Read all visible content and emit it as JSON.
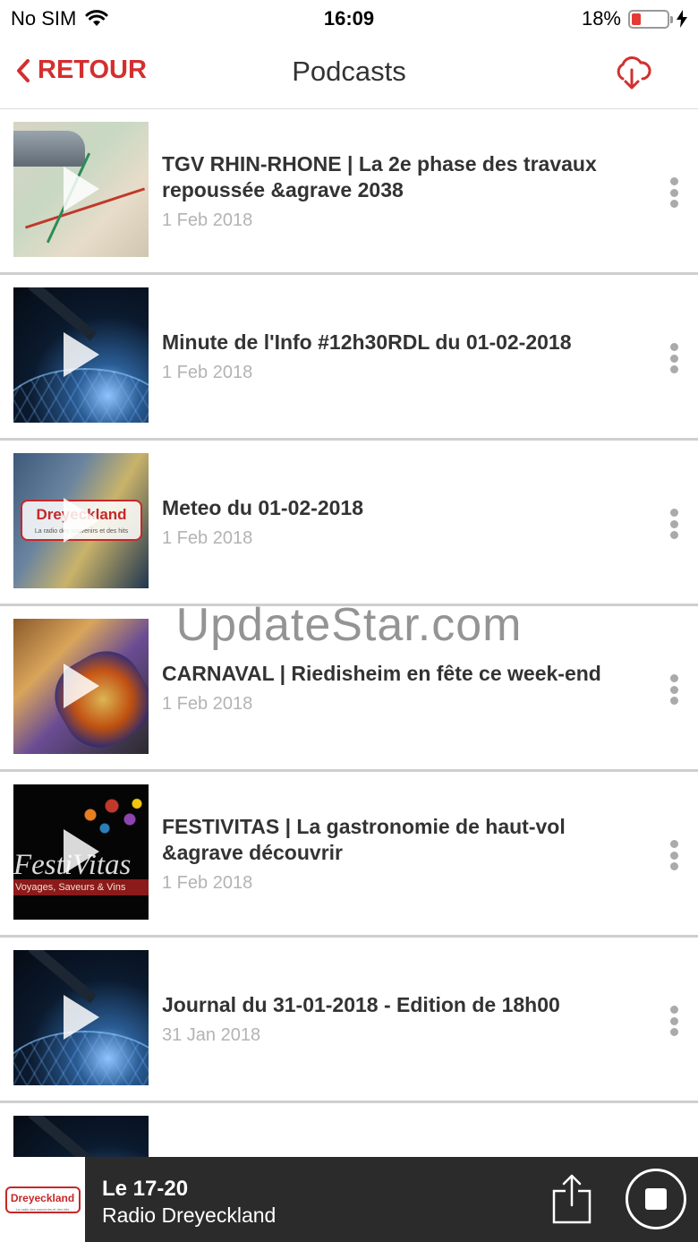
{
  "status_bar": {
    "carrier": "No SIM",
    "time": "16:09",
    "battery_percent": "18%",
    "battery_level": 0.18
  },
  "nav": {
    "back_label": "RETOUR",
    "title": "Podcasts",
    "download_icon": "cloud-download-icon"
  },
  "colors": {
    "accent": "#d32f2f",
    "player_bg": "#2b2b2b",
    "date_text": "#b3b3b3"
  },
  "podcasts": [
    {
      "title": "TGV RHIN-RHONE | La 2e phase des travaux repoussée &agrave 2038",
      "date": "1 Feb 2018"
    },
    {
      "title": "Minute de l'Info #12h30RDL du 01-02-2018",
      "date": "1 Feb 2018"
    },
    {
      "title": "Meteo du 01-02-2018",
      "date": "1 Feb 2018"
    },
    {
      "title": "CARNAVAL | Riedisheim en fête ce week-end",
      "date": "1 Feb 2018"
    },
    {
      "title": "FESTIVITAS | La gastronomie de haut-vol &agrave découvrir",
      "date": "1 Feb 2018"
    },
    {
      "title": "Journal du 31-01-2018 - Edition de 18h00",
      "date": "31 Jan 2018"
    }
  ],
  "thumbnails": {
    "meteo_logo": "Dreyeckland",
    "meteo_tagline": "La radio des souvenirs et des hits",
    "festivitas_word": "FestiVitas",
    "festivitas_band": "Voyages, Saveurs & Vins"
  },
  "watermark": "UpdateStar.com",
  "player": {
    "logo_text": "Dreyeckland",
    "logo_tagline": "La radio des souvenirs et des hits",
    "title": "Le 17-20",
    "subtitle": "Radio Dreyeckland"
  }
}
